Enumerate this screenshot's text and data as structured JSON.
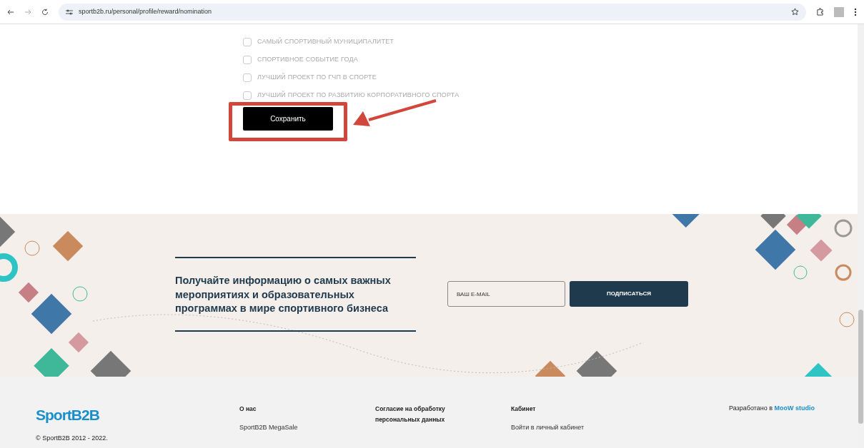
{
  "browser": {
    "url": "sportb2b.ru/personal/profile/reward/nomination"
  },
  "nominations": [
    {
      "label": "САМЫЙ СПОРТИВНЫЙ МУНИЦИПАЛИТЕТ",
      "checked": false
    },
    {
      "label": "СПОРТИВНОЕ СОБЫТИЕ ГОДА",
      "checked": false
    },
    {
      "label": "ЛУЧШИЙ ПРОЕКТ ПО ГЧП В СПОРТЕ",
      "checked": false
    },
    {
      "label": "ЛУЧШИЙ ПРОЕКТ ПО РАЗВИТИЮ КОРПОРАТИВНОГО СПОРТА",
      "checked": false
    }
  ],
  "save_button": "Сохранить",
  "subscribe": {
    "heading": "Получайте информацию о самых важных мероприятиях и образовательных программах в мире спортивного бизнеса",
    "email_placeholder": "ВАШ E-MAIL",
    "button": "ПОДПИСАТЬСЯ"
  },
  "footer": {
    "logo": "SportB2B",
    "copyright": "© SportB2B 2012 - 2022.",
    "columns": [
      {
        "title": "О нас",
        "links": [
          "SportB2B MegaSale"
        ]
      },
      {
        "title": "Согласие на обработку персональных данных"
      },
      {
        "title": "Кабинет",
        "links": [
          "Войти в личный кабинет"
        ]
      }
    ],
    "credit": "Разработано в",
    "credit_link": "MooW studio"
  }
}
